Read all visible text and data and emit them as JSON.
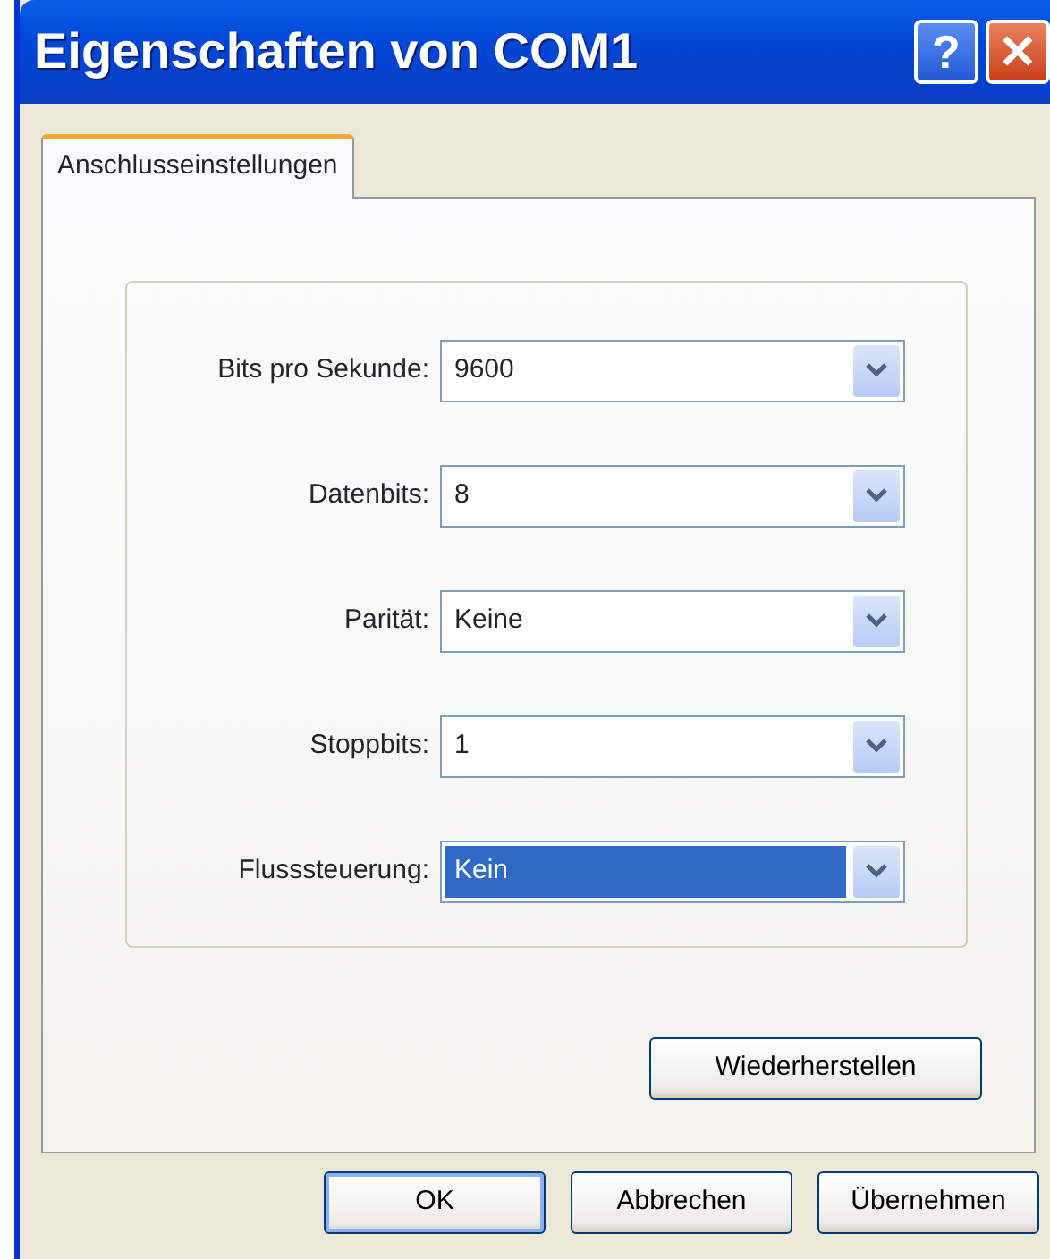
{
  "window": {
    "title": "Eigenschaften von COM1",
    "title_buttons": [
      "?",
      "✕"
    ]
  },
  "tabs": [
    {
      "label": "Anschlusseinstellungen",
      "selected": true
    }
  ],
  "fields": [
    {
      "label": "Bits pro Sekunde:",
      "value": "9600",
      "focused": false
    },
    {
      "label": "Datenbits:",
      "value": "8",
      "focused": false
    },
    {
      "label": "Parität:",
      "value": "Keine",
      "focused": false
    },
    {
      "label": "Stoppbits:",
      "value": "1",
      "focused": false
    },
    {
      "label": "Flusssteuerung:",
      "value": "Kein",
      "focused": true
    }
  ],
  "restore_button": "Wiederherstellen",
  "buttons": [
    {
      "label": "OK",
      "default": true
    },
    {
      "label": "Abbrechen",
      "default": false
    },
    {
      "label": "Übernehmen",
      "default": false
    }
  ]
}
